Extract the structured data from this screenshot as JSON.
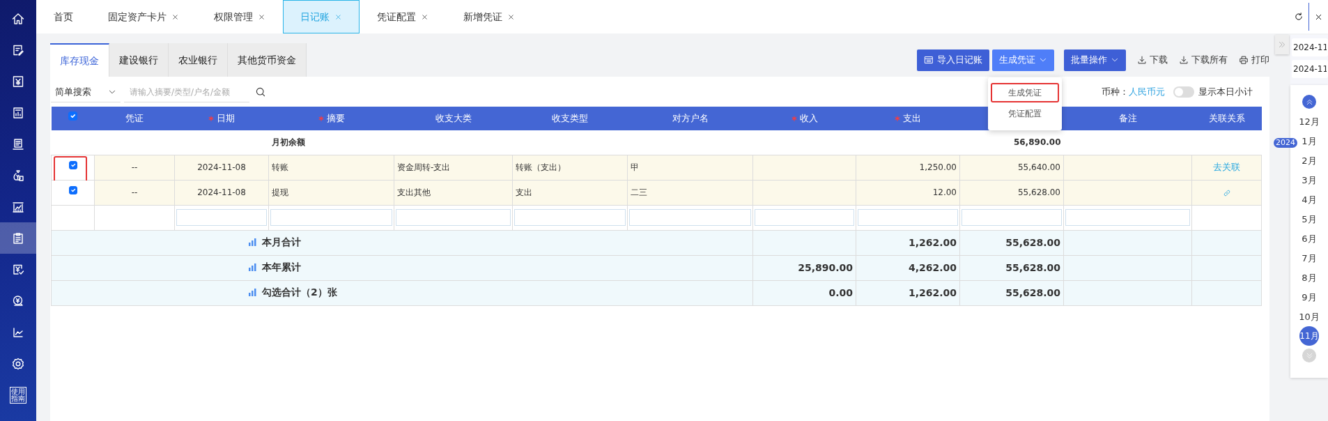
{
  "sidebar": {
    "items": [
      {
        "selected": false
      },
      {
        "selected": false
      },
      {
        "selected": false
      },
      {
        "selected": false
      },
      {
        "selected": false
      },
      {
        "selected": false
      },
      {
        "selected": false
      },
      {
        "selected": true
      },
      {
        "selected": false
      },
      {
        "selected": false
      },
      {
        "selected": false
      },
      {
        "selected": false
      },
      {
        "label": "使用指南",
        "selected": false
      }
    ]
  },
  "tabs": [
    {
      "label": "首页",
      "closable": false,
      "selected": false
    },
    {
      "label": "固定资产卡片",
      "closable": true,
      "selected": false
    },
    {
      "label": "权限管理",
      "closable": true,
      "selected": false
    },
    {
      "label": "日记账",
      "closable": true,
      "selected": true
    },
    {
      "label": "凭证配置",
      "closable": true,
      "selected": false
    },
    {
      "label": "新增凭证",
      "closable": true,
      "selected": false
    }
  ],
  "account_tabs": [
    {
      "label": "库存现金",
      "selected": true
    },
    {
      "label": "建设银行",
      "selected": false
    },
    {
      "label": "农业银行",
      "selected": false
    },
    {
      "label": "其他货币资金",
      "selected": false
    }
  ],
  "toolbar": [
    {
      "label": "导入日记账",
      "kind": "import"
    },
    {
      "label": "生成凭证",
      "kind": "menu",
      "expanded": true
    },
    {
      "label": "批量操作",
      "kind": "menu",
      "expanded": false
    },
    {
      "label": "下载",
      "kind": "download"
    },
    {
      "label": "下载所有",
      "kind": "download"
    },
    {
      "label": "打印",
      "kind": "print"
    }
  ],
  "dropdown_menu": {
    "items": [
      {
        "label": "生成凭证",
        "outlined": true
      },
      {
        "label": "凭证配置",
        "outlined": false
      }
    ]
  },
  "search": {
    "mode": "简单搜索",
    "placeholder": "请输入摘要/类型/户名/金额"
  },
  "currency": {
    "label": "币种：",
    "value": "人民币元"
  },
  "daily_subtotal": {
    "label": "显示本日小计",
    "on": false
  },
  "table": {
    "select_all": true,
    "checkboxes_outlined": true,
    "columns": [
      {
        "label": "凭证",
        "required": false
      },
      {
        "label": "日期",
        "required": true
      },
      {
        "label": "摘要",
        "required": true
      },
      {
        "label": "收支大类",
        "required": false
      },
      {
        "label": "收支类型",
        "required": false
      },
      {
        "label": "对方户名",
        "required": false
      },
      {
        "label": "收入",
        "required": true
      },
      {
        "label": "支出",
        "required": true
      },
      {
        "label": "备注",
        "required": false
      },
      {
        "label": "关联关系",
        "required": false
      }
    ],
    "opening_row": {
      "label": "月初余额",
      "balance": "56,890.00"
    },
    "rows": [
      {
        "checked": true,
        "voucher": "--",
        "date": "2024-11-08",
        "summary": "转账",
        "category": "资金周转-支出",
        "type": "转账（支出）",
        "counterparty": "甲",
        "expense": "1,250.00",
        "balance": "55,640.00",
        "relation": {
          "kind": "text",
          "label": "去关联"
        }
      },
      {
        "checked": true,
        "voucher": "--",
        "date": "2024-11-08",
        "summary": "提现",
        "category": "支出其他",
        "type": "支出",
        "counterparty": "二三",
        "expense": "12.00",
        "balance": "55,628.00",
        "relation": {
          "kind": "icon"
        }
      }
    ],
    "entry_row": true,
    "totals": [
      {
        "label": "本月合计",
        "expense": "1,262.00",
        "balance": "55,628.00"
      },
      {
        "label": "本年累计",
        "income": "25,890.00",
        "expense": "4,262.00",
        "balance": "55,628.00"
      },
      {
        "label": "勾选合计（2）张",
        "income": "0.00",
        "expense": "1,262.00",
        "balance": "55,628.00"
      }
    ]
  },
  "date_panel": {
    "start": "2024-11",
    "end": "2024-11",
    "year": "2024",
    "months": [
      {
        "label": "12月",
        "selected": false
      },
      {
        "label": "1月",
        "selected": false
      },
      {
        "label": "2月",
        "selected": false
      },
      {
        "label": "3月",
        "selected": false
      },
      {
        "label": "4月",
        "selected": false
      },
      {
        "label": "5月",
        "selected": false
      },
      {
        "label": "6月",
        "selected": false
      },
      {
        "label": "7月",
        "selected": false
      },
      {
        "label": "8月",
        "selected": false
      },
      {
        "label": "9月",
        "selected": false
      },
      {
        "label": "10月",
        "selected": false
      },
      {
        "label": "11月",
        "selected": true
      }
    ]
  }
}
